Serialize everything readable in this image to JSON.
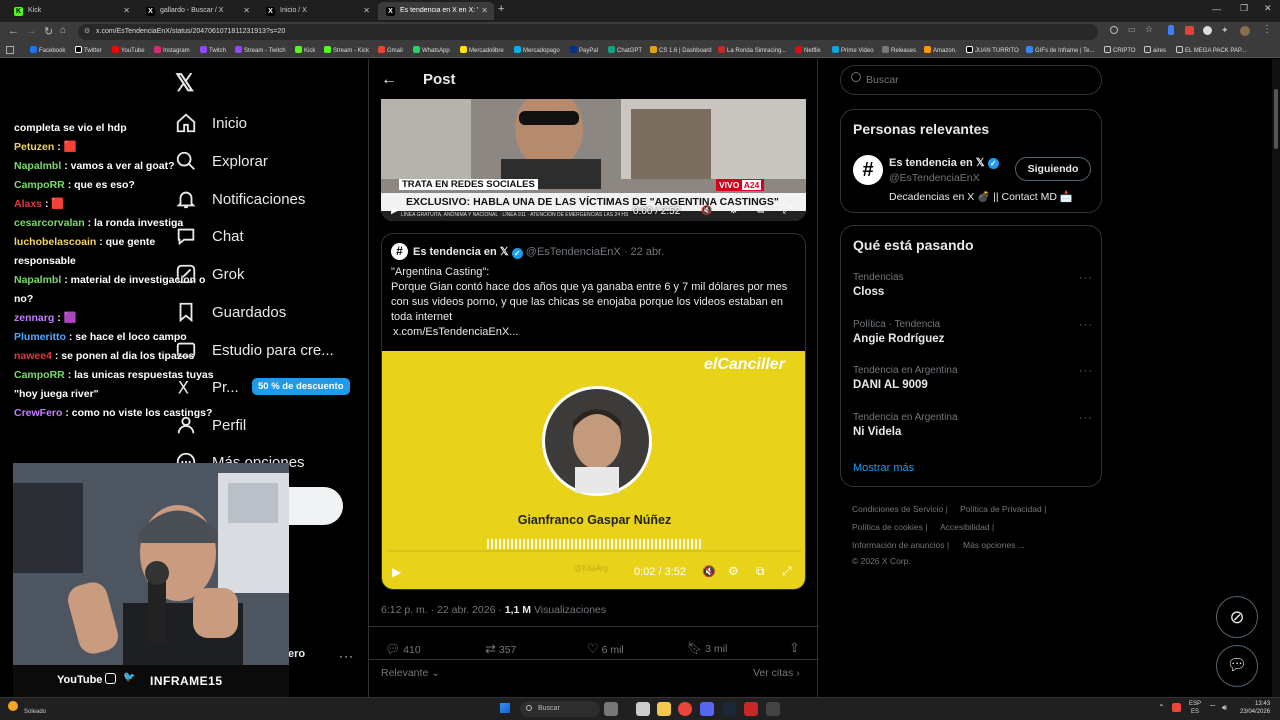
{
  "browser": {
    "tabs": [
      {
        "label": "Kick",
        "active": false
      },
      {
        "label": "gallardo - Buscar / X",
        "active": false
      },
      {
        "label": "Inicio / X",
        "active": false
      },
      {
        "label": "Es tendencia en X en X: \"\"Arge",
        "active": true
      }
    ],
    "url": "x.com/EsTendenciaEnX/status/2047061071811231913?s=20",
    "bookmarks": [
      "Facebook",
      "Twitter",
      "YouTube",
      "Instagram",
      "Twitch",
      "Stream - Twitch",
      "Kick",
      "Stream - Kick",
      "Gmail",
      "WhatsApp",
      "Mercadolibre",
      "Mercadopago",
      "PayPal",
      "ChatGPT",
      "CS 1.6 | Dashboard",
      "La Ronda Simracing...",
      "Netflix",
      "Prime Video",
      "Releases",
      "Amazon.",
      "JUAN TURRITO",
      "GIFs de Inframe | Te...",
      "CRIPTO",
      "aires",
      "EL MEGA PACK PAP..."
    ]
  },
  "nav": {
    "items": [
      {
        "label": "Inicio",
        "icon": "home-icon"
      },
      {
        "label": "Explorar",
        "icon": "search-icon"
      },
      {
        "label": "Notificaciones",
        "icon": "bell-icon"
      },
      {
        "label": "Chat",
        "icon": "chat-icon"
      },
      {
        "label": "Grok",
        "icon": "grok-icon"
      },
      {
        "label": "Guardados",
        "icon": "bookmark-icon"
      },
      {
        "label": "Estudio para cre...",
        "icon": "studio-icon"
      },
      {
        "label": "Pr...",
        "icon": "premium-icon"
      },
      {
        "label": "Perfil",
        "icon": "user-icon"
      },
      {
        "label": "Más opciones",
        "icon": "more-icon"
      }
    ],
    "premium_badge": "50 % de descuento",
    "account_tail": "ero"
  },
  "chat": [
    {
      "user": "",
      "msg": "completa se vio el hdp",
      "color": "#ffffff"
    },
    {
      "user": "Petuzen",
      "msg": ": 🟥",
      "color": "#f4d35e"
    },
    {
      "user": "Napalmbl",
      "msg": ": vamos a ver al goat?",
      "color": "#7bd96b"
    },
    {
      "user": "CampoRR",
      "msg": ": que es eso?",
      "color": "#7bd96b"
    },
    {
      "user": "Alaxs",
      "msg": ": 🟥",
      "color": "#e0393e"
    },
    {
      "user": "cesarcorvalan",
      "msg": ": la ronda investiga",
      "color": "#7bd96b"
    },
    {
      "user": "luchobelascoain",
      "msg": ": que gente responsable",
      "color": "#f4d35e"
    },
    {
      "user": "Napalmbl",
      "msg": ": material de investigacion o no?",
      "color": "#7bd96b"
    },
    {
      "user": "zennarg",
      "msg": ": 🟪",
      "color": "#c77dff"
    },
    {
      "user": "Plumeritto",
      "msg": ": se hace el loco campo",
      "color": "#4ea8ff"
    },
    {
      "user": "nawee4",
      "msg": ": se ponen al dia los tipazos",
      "color": "#e0393e"
    },
    {
      "user": "CampoRR",
      "msg": ": las unicas respuestas tuyas \"hoy juega river\"",
      "color": "#7bd96b"
    },
    {
      "user": "CrewFero",
      "msg": ": como no viste los castings?",
      "color": "#c77dff"
    }
  ],
  "stream": {
    "brand": "INFRAME15",
    "social_labels": [
      "YouTube"
    ]
  },
  "post": {
    "header_title": "Post",
    "video1": {
      "banner_top": "TRATA EN REDES SOCIALES",
      "banner_main": "EXCLUSIVO: HABLA UNA DE LAS VÍCTIMAS DE \"ARGENTINA CASTINGS\"",
      "ticker": "LÍNEA GRATUITA, ANÓNIMA Y NACIONAL · LÍNEA 911 · ATENCIÓN DE EMERGENCIAS LAS 24 HS",
      "live": "VIVO",
      "channel": "A24",
      "time": "0:00 / 2:52"
    },
    "quote": {
      "author": "Es tendencia en 𝕏",
      "handle": "@EsTendenciaEnX",
      "date": "· 22 abr.",
      "line1": "\"Argentina Casting\":",
      "line2": "Porque Gian contó hace dos años que ya ganaba entre 6 y 7 mil dólares por mes con sus videos porno, y que las chicas se enojaba porque los videos estaban en toda internet",
      "link": "x.com/EsTendenciaEnX..."
    },
    "video2": {
      "brand": "elCanciller",
      "person": "Gianfranco Gaspar Núñez",
      "watermark": "@KilaArg",
      "time": "0:02 / 3:52"
    },
    "meta": {
      "time": "6:12 p. m. · 22 abr. 2026 ·",
      "views": "1,1 M",
      "views_label": "Visualizaciones"
    },
    "actions": {
      "replies": "410",
      "reposts": "357",
      "likes": "6 mil",
      "bookmarks": "3 mil"
    },
    "sort": "Relevante",
    "citas": "Ver citas"
  },
  "right": {
    "search_placeholder": "Buscar",
    "relevant_title": "Personas relevantes",
    "person": {
      "name": "Es tendencia en 𝕏",
      "handle": "@EsTendenciaEnX",
      "bio": "Decadencias en X 💣 || Contact MD 📩",
      "follow": "Siguiendo"
    },
    "trends_title": "Qué está pasando",
    "trends": [
      {
        "meta": "Tendencias",
        "name": "Closs"
      },
      {
        "meta": "Política · Tendencia",
        "name": "Angie Rodríguez"
      },
      {
        "meta": "Tendencia en Argentina",
        "name": "DANI AL 9009"
      },
      {
        "meta": "Tendencia en Argentina",
        "name": "Ni Videla"
      }
    ],
    "more": "Mostrar más",
    "footer": [
      "Condiciones de Servicio",
      "Política de Privacidad",
      "Política de cookies",
      "Accesibilidad",
      "Información de anuncios",
      "Más opciones ...",
      "© 2026 X Corp."
    ]
  },
  "taskbar": {
    "weather": "Soleado",
    "search": "Buscar",
    "lang1": "ESP",
    "lang2": "ES",
    "time": "13:43",
    "date": "23/04/2026"
  },
  "colors": {
    "accent": "#1d9bf0",
    "yellow": "#e8d31a",
    "live_red": "#d6001c"
  }
}
